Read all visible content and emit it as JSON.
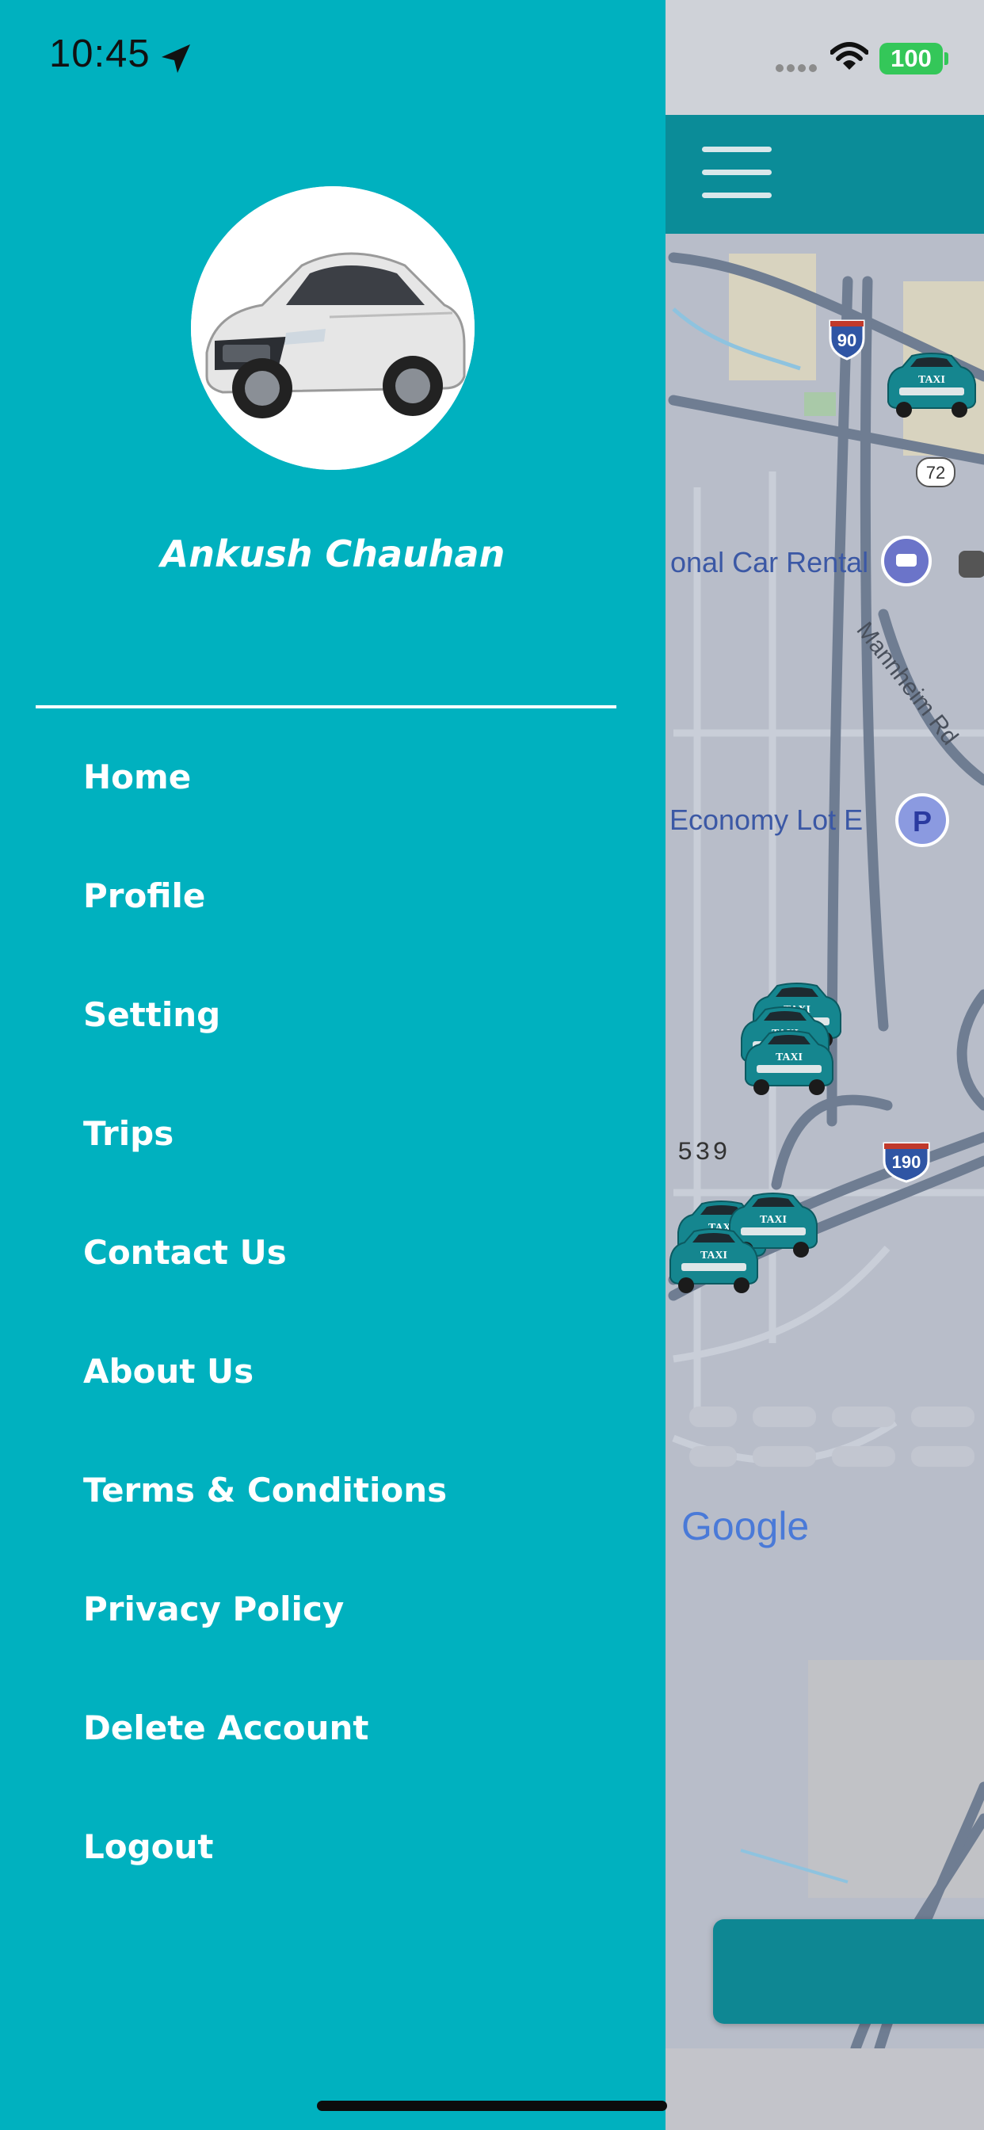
{
  "status_bar": {
    "time": "10:45",
    "battery_level": "100",
    "icons": [
      "location-arrow-icon",
      "cellular-signal-icon",
      "wifi-icon",
      "battery-icon"
    ]
  },
  "drawer": {
    "user_name": "Ankush Chauhan",
    "avatar": "car-avatar",
    "menu_items": [
      {
        "label": "Home"
      },
      {
        "label": "Profile"
      },
      {
        "label": "Setting"
      },
      {
        "label": "Trips"
      },
      {
        "label": "Contact Us"
      },
      {
        "label": "About Us"
      },
      {
        "label": "Terms & Conditions"
      },
      {
        "label": "Privacy Policy"
      },
      {
        "label": "Delete Account"
      },
      {
        "label": "Logout"
      }
    ]
  },
  "app": {
    "menu_icon": "hamburger-menu-icon",
    "map": {
      "labels": {
        "car_rental": "onal Car Rental",
        "economy_lot": "Economy Lot E",
        "parking_badge": "P",
        "road_name": "Mannheim Rd",
        "route_number": "539",
        "brand": "Google"
      },
      "shields": {
        "interstate_90": "90",
        "interstate_190": "190",
        "state_route_72": "72"
      },
      "taxi_sign": "TAXI"
    }
  },
  "colors": {
    "drawer": "#00b1bf",
    "topbar": "#0b8c98",
    "map_bg": "#b8bdc9",
    "road": "#6f7d92"
  }
}
